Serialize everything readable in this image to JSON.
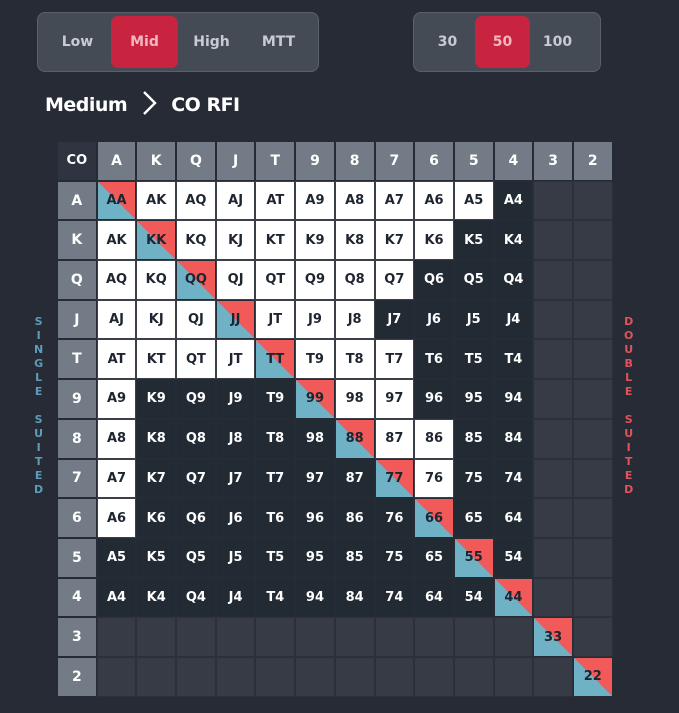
{
  "stakes_selector": {
    "options": [
      "Low",
      "Mid",
      "High",
      "MTT"
    ],
    "selected": "Mid"
  },
  "stack_selector": {
    "options": [
      "30",
      "50",
      "100"
    ],
    "selected": "50"
  },
  "breadcrumb": {
    "level": "Medium",
    "separator_icon": "chevron-right-icon",
    "scenario": "CO RFI"
  },
  "side_labels": {
    "left": "SINGLE SUITED",
    "right": "DOUBLE SUITED"
  },
  "colors": {
    "raise": "#ffffff",
    "fold": "#222a33",
    "empty": "#363b46",
    "pair_top": "#f25a5a",
    "pair_bottom": "#6fb2c6",
    "active": "#c8243f"
  },
  "matrix": {
    "corner": "CO",
    "ranks": [
      "A",
      "K",
      "Q",
      "J",
      "T",
      "9",
      "8",
      "7",
      "6",
      "5",
      "4",
      "3",
      "2"
    ],
    "rows": [
      {
        "rank": "A",
        "cells": [
          [
            "AA",
            "pair"
          ],
          [
            "AK",
            "raise"
          ],
          [
            "AQ",
            "raise"
          ],
          [
            "AJ",
            "raise"
          ],
          [
            "AT",
            "raise"
          ],
          [
            "A9",
            "raise"
          ],
          [
            "A8",
            "raise"
          ],
          [
            "A7",
            "raise"
          ],
          [
            "A6",
            "raise"
          ],
          [
            "A5",
            "raise"
          ],
          [
            "A4",
            "fold"
          ],
          [
            "",
            "empty"
          ],
          [
            "",
            "empty"
          ]
        ]
      },
      {
        "rank": "K",
        "cells": [
          [
            "AK",
            "raise"
          ],
          [
            "KK",
            "pair"
          ],
          [
            "KQ",
            "raise"
          ],
          [
            "KJ",
            "raise"
          ],
          [
            "KT",
            "raise"
          ],
          [
            "K9",
            "raise"
          ],
          [
            "K8",
            "raise"
          ],
          [
            "K7",
            "raise"
          ],
          [
            "K6",
            "raise"
          ],
          [
            "K5",
            "fold"
          ],
          [
            "K4",
            "fold"
          ],
          [
            "",
            "empty"
          ],
          [
            "",
            "empty"
          ]
        ]
      },
      {
        "rank": "Q",
        "cells": [
          [
            "AQ",
            "raise"
          ],
          [
            "KQ",
            "raise"
          ],
          [
            "QQ",
            "pair"
          ],
          [
            "QJ",
            "raise"
          ],
          [
            "QT",
            "raise"
          ],
          [
            "Q9",
            "raise"
          ],
          [
            "Q8",
            "raise"
          ],
          [
            "Q7",
            "raise"
          ],
          [
            "Q6",
            "fold"
          ],
          [
            "Q5",
            "fold"
          ],
          [
            "Q4",
            "fold"
          ],
          [
            "",
            "empty"
          ],
          [
            "",
            "empty"
          ]
        ]
      },
      {
        "rank": "J",
        "cells": [
          [
            "AJ",
            "raise"
          ],
          [
            "KJ",
            "raise"
          ],
          [
            "QJ",
            "raise"
          ],
          [
            "JJ",
            "pair"
          ],
          [
            "JT",
            "raise"
          ],
          [
            "J9",
            "raise"
          ],
          [
            "J8",
            "raise"
          ],
          [
            "J7",
            "fold"
          ],
          [
            "J6",
            "fold"
          ],
          [
            "J5",
            "fold"
          ],
          [
            "J4",
            "fold"
          ],
          [
            "",
            "empty"
          ],
          [
            "",
            "empty"
          ]
        ]
      },
      {
        "rank": "T",
        "cells": [
          [
            "AT",
            "raise"
          ],
          [
            "KT",
            "raise"
          ],
          [
            "QT",
            "raise"
          ],
          [
            "JT",
            "raise"
          ],
          [
            "TT",
            "pair"
          ],
          [
            "T9",
            "raise"
          ],
          [
            "T8",
            "raise"
          ],
          [
            "T7",
            "raise"
          ],
          [
            "T6",
            "fold"
          ],
          [
            "T5",
            "fold"
          ],
          [
            "T4",
            "fold"
          ],
          [
            "",
            "empty"
          ],
          [
            "",
            "empty"
          ]
        ]
      },
      {
        "rank": "9",
        "cells": [
          [
            "A9",
            "raise"
          ],
          [
            "K9",
            "fold"
          ],
          [
            "Q9",
            "fold"
          ],
          [
            "J9",
            "fold"
          ],
          [
            "T9",
            "fold"
          ],
          [
            "99",
            "pair"
          ],
          [
            "98",
            "raise"
          ],
          [
            "97",
            "raise"
          ],
          [
            "96",
            "fold"
          ],
          [
            "95",
            "fold"
          ],
          [
            "94",
            "fold"
          ],
          [
            "",
            "empty"
          ],
          [
            "",
            "empty"
          ]
        ]
      },
      {
        "rank": "8",
        "cells": [
          [
            "A8",
            "raise"
          ],
          [
            "K8",
            "fold"
          ],
          [
            "Q8",
            "fold"
          ],
          [
            "J8",
            "fold"
          ],
          [
            "T8",
            "fold"
          ],
          [
            "98",
            "fold"
          ],
          [
            "88",
            "pair"
          ],
          [
            "87",
            "raise"
          ],
          [
            "86",
            "raise"
          ],
          [
            "85",
            "fold"
          ],
          [
            "84",
            "fold"
          ],
          [
            "",
            "empty"
          ],
          [
            "",
            "empty"
          ]
        ]
      },
      {
        "rank": "7",
        "cells": [
          [
            "A7",
            "raise"
          ],
          [
            "K7",
            "fold"
          ],
          [
            "Q7",
            "fold"
          ],
          [
            "J7",
            "fold"
          ],
          [
            "T7",
            "fold"
          ],
          [
            "97",
            "fold"
          ],
          [
            "87",
            "fold"
          ],
          [
            "77",
            "pair"
          ],
          [
            "76",
            "raise"
          ],
          [
            "75",
            "fold"
          ],
          [
            "74",
            "fold"
          ],
          [
            "",
            "empty"
          ],
          [
            "",
            "empty"
          ]
        ]
      },
      {
        "rank": "6",
        "cells": [
          [
            "A6",
            "raise"
          ],
          [
            "K6",
            "fold"
          ],
          [
            "Q6",
            "fold"
          ],
          [
            "J6",
            "fold"
          ],
          [
            "T6",
            "fold"
          ],
          [
            "96",
            "fold"
          ],
          [
            "86",
            "fold"
          ],
          [
            "76",
            "fold"
          ],
          [
            "66",
            "pair"
          ],
          [
            "65",
            "fold"
          ],
          [
            "64",
            "fold"
          ],
          [
            "",
            "empty"
          ],
          [
            "",
            "empty"
          ]
        ]
      },
      {
        "rank": "5",
        "cells": [
          [
            "A5",
            "fold"
          ],
          [
            "K5",
            "fold"
          ],
          [
            "Q5",
            "fold"
          ],
          [
            "J5",
            "fold"
          ],
          [
            "T5",
            "fold"
          ],
          [
            "95",
            "fold"
          ],
          [
            "85",
            "fold"
          ],
          [
            "75",
            "fold"
          ],
          [
            "65",
            "fold"
          ],
          [
            "55",
            "pair"
          ],
          [
            "54",
            "fold"
          ],
          [
            "",
            "empty"
          ],
          [
            "",
            "empty"
          ]
        ]
      },
      {
        "rank": "4",
        "cells": [
          [
            "A4",
            "fold"
          ],
          [
            "K4",
            "fold"
          ],
          [
            "Q4",
            "fold"
          ],
          [
            "J4",
            "fold"
          ],
          [
            "T4",
            "fold"
          ],
          [
            "94",
            "fold"
          ],
          [
            "84",
            "fold"
          ],
          [
            "74",
            "fold"
          ],
          [
            "64",
            "fold"
          ],
          [
            "54",
            "fold"
          ],
          [
            "44",
            "pair"
          ],
          [
            "",
            "empty"
          ],
          [
            "",
            "empty"
          ]
        ]
      },
      {
        "rank": "3",
        "cells": [
          [
            "",
            "empty"
          ],
          [
            "",
            "empty"
          ],
          [
            "",
            "empty"
          ],
          [
            "",
            "empty"
          ],
          [
            "",
            "empty"
          ],
          [
            "",
            "empty"
          ],
          [
            "",
            "empty"
          ],
          [
            "",
            "empty"
          ],
          [
            "",
            "empty"
          ],
          [
            "",
            "empty"
          ],
          [
            "",
            "empty"
          ],
          [
            "33",
            "pair"
          ],
          [
            "",
            "empty"
          ]
        ]
      },
      {
        "rank": "2",
        "cells": [
          [
            "",
            "empty"
          ],
          [
            "",
            "empty"
          ],
          [
            "",
            "empty"
          ],
          [
            "",
            "empty"
          ],
          [
            "",
            "empty"
          ],
          [
            "",
            "empty"
          ],
          [
            "",
            "empty"
          ],
          [
            "",
            "empty"
          ],
          [
            "",
            "empty"
          ],
          [
            "",
            "empty"
          ],
          [
            "",
            "empty"
          ],
          [
            "",
            "empty"
          ],
          [
            "22",
            "pair"
          ]
        ]
      }
    ]
  }
}
